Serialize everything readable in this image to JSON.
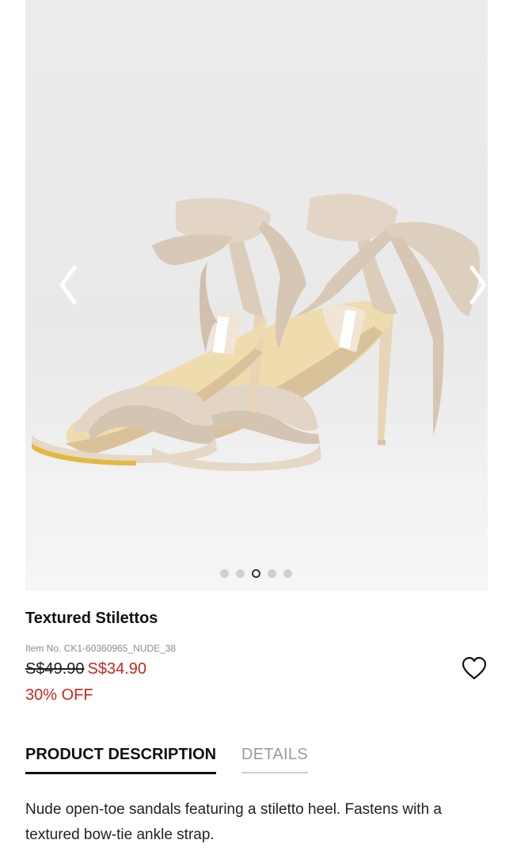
{
  "gallery": {
    "image_alt": "Nude textured stiletto sandals with bow-tie ankle straps",
    "dot_count": 5,
    "active_dot": 3
  },
  "product": {
    "title": "Textured Stilettos",
    "item_no": "Item No. CK1-60360965_NUDE_38",
    "old_price": "S$49.90",
    "new_price": "S$34.90",
    "discount": "30% OFF"
  },
  "tabs": [
    {
      "label": "PRODUCT DESCRIPTION",
      "active": true
    },
    {
      "label": "DETAILS",
      "active": false
    }
  ],
  "description": "Nude open-toe sandals featuring a stiletto heel. Fastens with a textured bow-tie ankle strap.",
  "icons": {
    "prev": "chevron-left-icon",
    "next": "chevron-right-icon",
    "wishlist": "heart-outline-icon"
  },
  "colors": {
    "sale_red": "#c8281e",
    "shoe_nude": "#e2d5c5",
    "insole": "#f0dfae"
  }
}
